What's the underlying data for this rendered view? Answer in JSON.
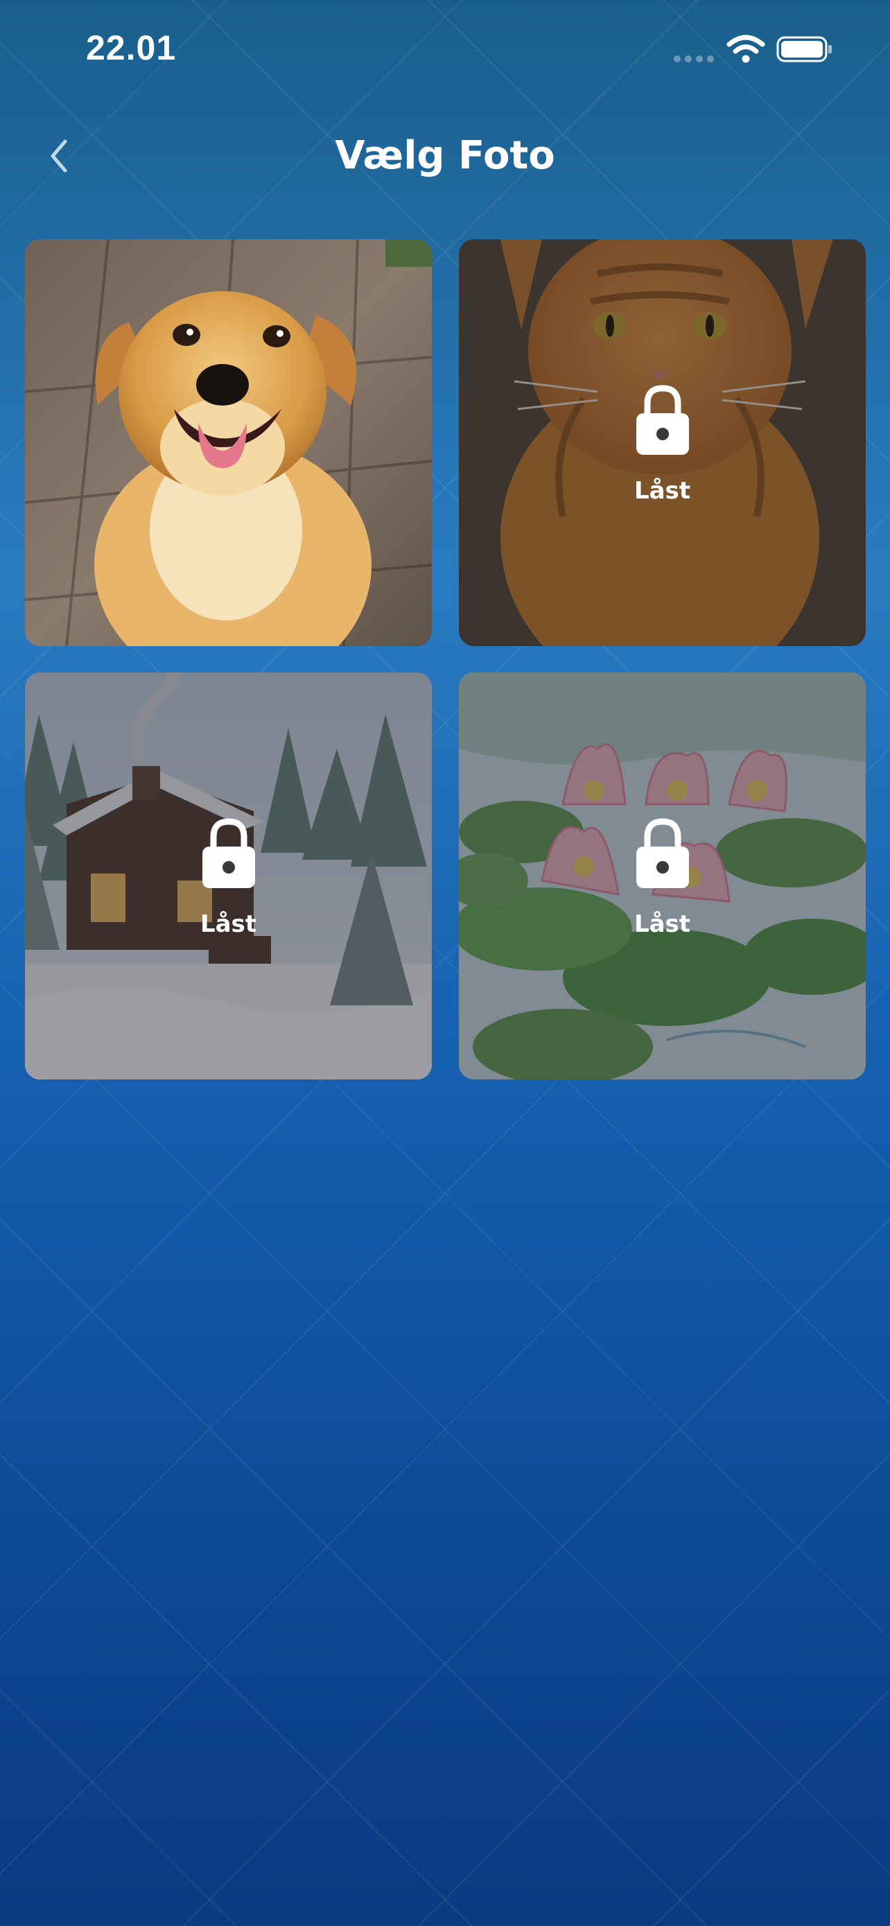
{
  "status_bar": {
    "time": "22.01"
  },
  "header": {
    "title": "Vælg Foto"
  },
  "photos": [
    {
      "subject": "dog",
      "locked": false
    },
    {
      "subject": "cat",
      "locked": true,
      "lock_label": "Låst"
    },
    {
      "subject": "winter-cabin",
      "locked": true,
      "lock_label": "Låst"
    },
    {
      "subject": "water-lilies",
      "locked": true,
      "lock_label": "Låst"
    }
  ],
  "colors": {
    "background_top": "#1a5f8c",
    "background_bottom": "#0b3a80",
    "text": "#ffffff"
  }
}
